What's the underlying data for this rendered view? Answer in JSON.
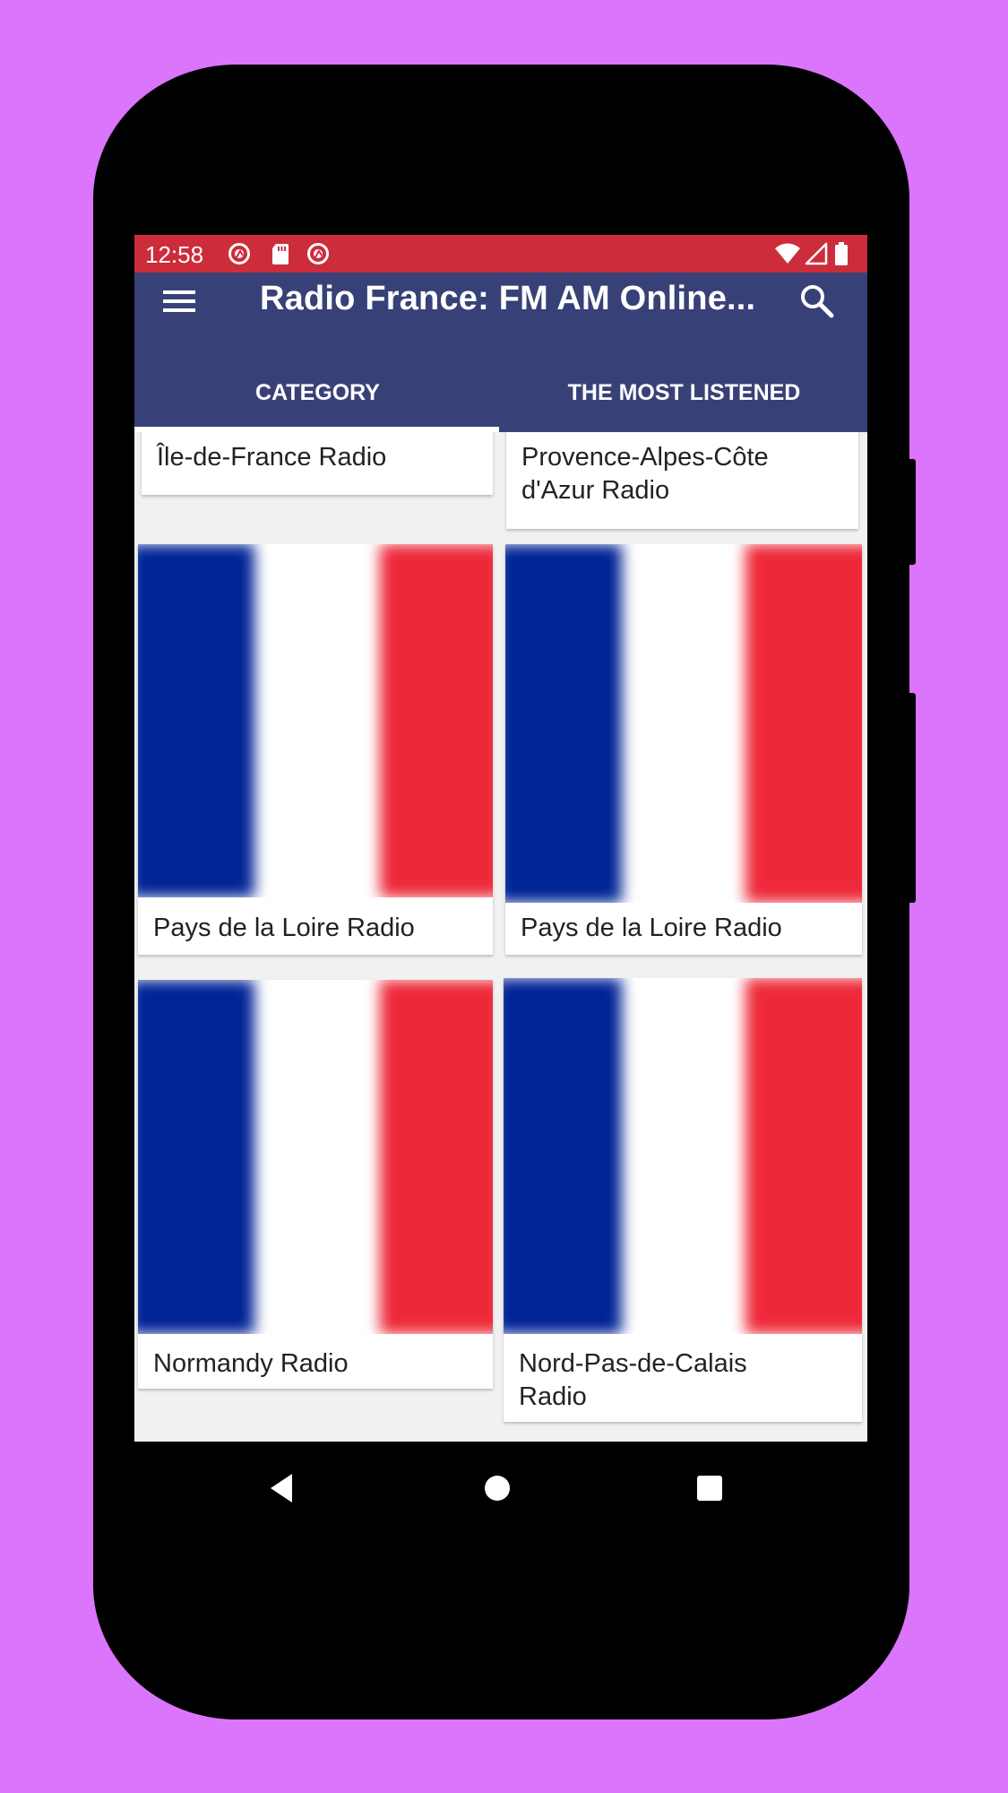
{
  "colors": {
    "background": "#db75fb",
    "status_bar": "#cd2c3b",
    "app_bar": "#384177",
    "flag_blue": "#002395",
    "flag_red": "#ed2939"
  },
  "status_bar": {
    "time": "12:58",
    "left_icons": [
      "app-notification-icon",
      "sd-card-icon",
      "app-notification-icon"
    ],
    "right_icons": [
      "wifi-icon",
      "cellular-signal-icon",
      "battery-icon"
    ]
  },
  "app_bar": {
    "title": "Radio France: FM AM Online...",
    "menu_icon": "hamburger-menu-icon",
    "search_icon": "search-icon"
  },
  "tabs": [
    {
      "label": "CATEGORY",
      "selected": true
    },
    {
      "label": "THE MOST LISTENED",
      "selected": false
    }
  ],
  "categories": [
    {
      "label": "Île-de-France Radio",
      "image": "france-flag"
    },
    {
      "label": "Provence-Alpes-Côte d'Azur Radio",
      "image": "france-flag"
    },
    {
      "label": "Pays de la Loire Radio",
      "image": "france-flag"
    },
    {
      "label": "Pays de la Loire Radio",
      "image": "france-flag"
    },
    {
      "label": "Normandy Radio",
      "image": "france-flag"
    },
    {
      "label": "Nord-Pas-de-Calais Radio",
      "image": "france-flag"
    }
  ],
  "nav_bar": {
    "back": "back-icon",
    "home": "home-icon",
    "recents": "recents-icon"
  }
}
